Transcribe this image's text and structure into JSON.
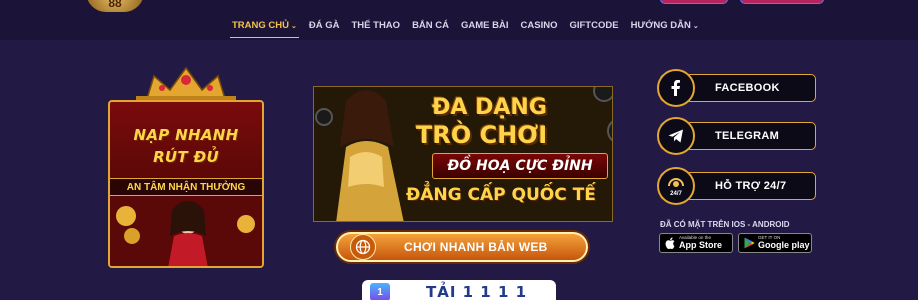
{
  "header": {
    "logo_text": "88",
    "nav": [
      {
        "label": "TRANG CHỦ",
        "caret": true,
        "active": true
      },
      {
        "label": "ĐÁ GÀ",
        "caret": false,
        "active": false
      },
      {
        "label": "THỂ THAO",
        "caret": false,
        "active": false
      },
      {
        "label": "BẮN CÁ",
        "caret": false,
        "active": false
      },
      {
        "label": "GAME BÀI",
        "caret": false,
        "active": false
      },
      {
        "label": "CASINO",
        "caret": false,
        "active": false
      },
      {
        "label": "GIFTCODE",
        "caret": false,
        "active": false
      },
      {
        "label": "HƯỚNG DẪN",
        "caret": true,
        "active": false
      }
    ]
  },
  "promo": {
    "line1": "NẠP NHANH",
    "line2": "RÚT ĐỦ",
    "strip": "AN TÂM NHẬN THƯỞNG"
  },
  "banner": {
    "title1": "ĐA DẠNG",
    "title2": "TRÒ CHƠI",
    "ribbon": "ĐỒ HOẠ CỰC ĐỈNH",
    "title3": "ĐẲNG CẤP QUỐC TẾ"
  },
  "play_web": {
    "label": "CHƠI NHANH BẢN WEB"
  },
  "download": {
    "badge": "1",
    "text": "TẢI 1 1 1 1"
  },
  "social": [
    {
      "label": "FACEBOOK",
      "icon": "facebook-icon"
    },
    {
      "label": "TELEGRAM",
      "icon": "telegram-icon"
    },
    {
      "label": "HỖ TRỢ 24/7",
      "icon": "support-24-7-icon",
      "icon_text": "24/7"
    }
  ],
  "apps": {
    "available": "ĐÃ CÓ MẶT TRÊN IOS - ANDROID",
    "app_store_small": "Available on the",
    "app_store": "App Store",
    "google_play_small": "GET IT ON",
    "google_play": "Google play"
  },
  "colors": {
    "background": "#221a45",
    "accent_gold": "#e3a630",
    "nav_active": "#f3c24b"
  }
}
